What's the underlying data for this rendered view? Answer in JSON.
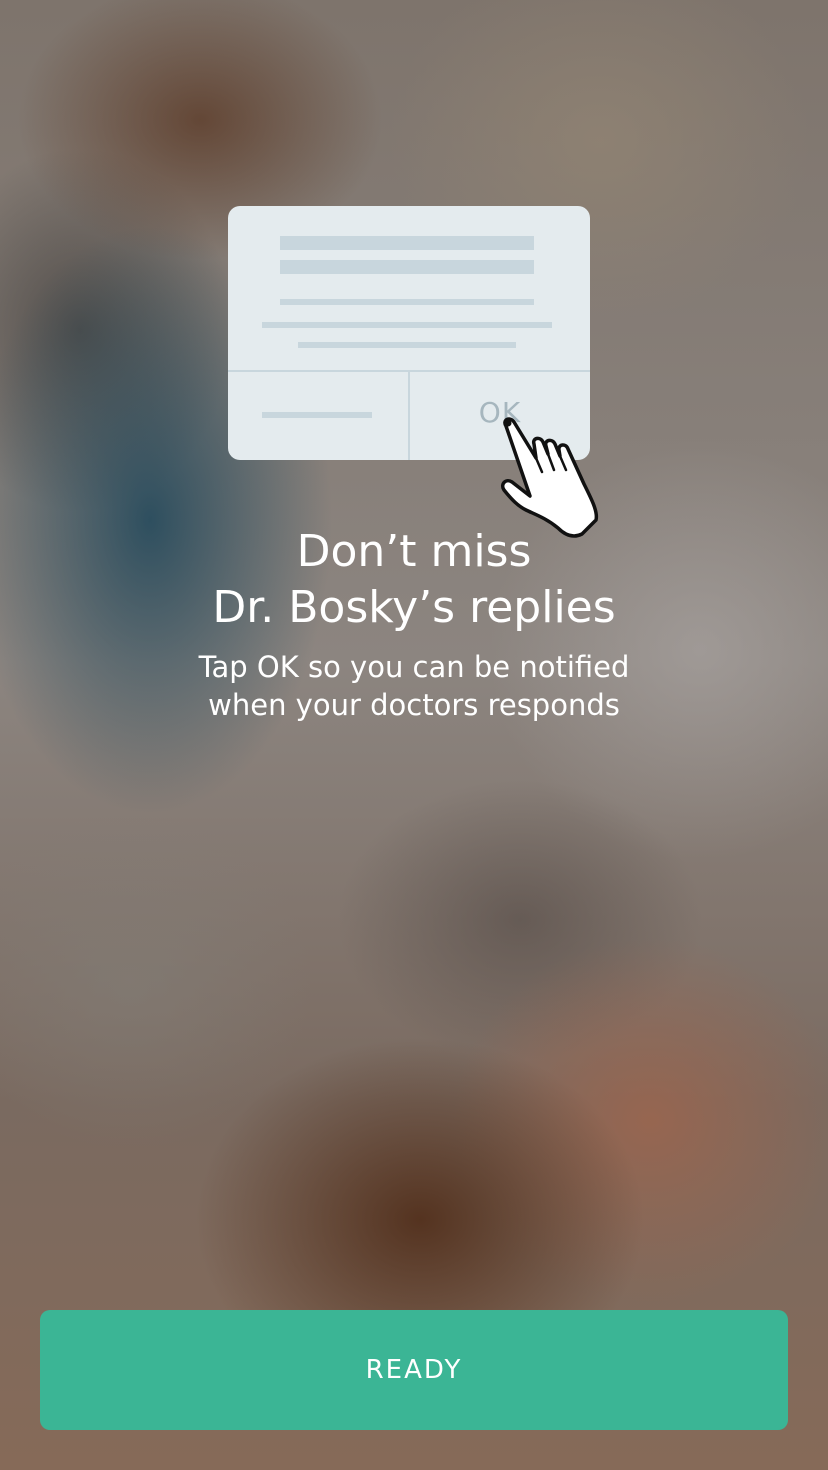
{
  "illustration": {
    "ok_label": "OK",
    "hand_icon": "pointing-hand-icon"
  },
  "headline": {
    "line1": "Don’t miss",
    "line2": "Dr. Bosky’s replies"
  },
  "subtext": {
    "line1": "Tap OK so you can be notified",
    "line2": "when your doctors responds"
  },
  "ready_button": {
    "label": "READY"
  },
  "colors": {
    "accent": "#3bb595",
    "card_bg": "#e4ebee",
    "card_lines": "#c8d6dd"
  }
}
